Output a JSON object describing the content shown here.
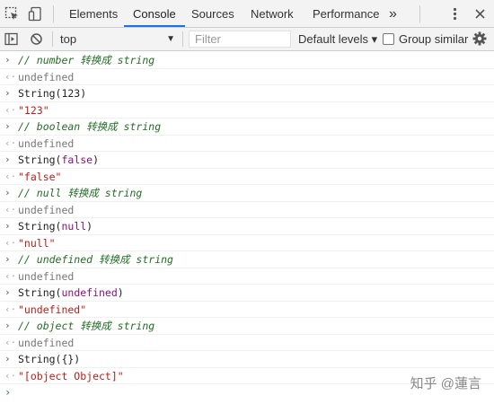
{
  "tabs": [
    "Elements",
    "Console",
    "Sources",
    "Network",
    "Performance"
  ],
  "more_tabs": "»",
  "toolbar": {
    "context": "top",
    "filter_placeholder": "Filter",
    "levels": "Default levels ▾",
    "group_similar": "Group similar"
  },
  "console": [
    {
      "kind": "in",
      "parts": [
        {
          "t": "// number 转换成 string",
          "c": "comment"
        }
      ]
    },
    {
      "kind": "out",
      "parts": [
        {
          "t": "undefined",
          "c": "undef"
        }
      ]
    },
    {
      "kind": "in",
      "parts": [
        {
          "t": "String(123)",
          "c": "plain"
        }
      ]
    },
    {
      "kind": "out",
      "parts": [
        {
          "t": "\"123\"",
          "c": "str"
        }
      ]
    },
    {
      "kind": "in",
      "parts": [
        {
          "t": "// boolean 转换成 string",
          "c": "comment"
        }
      ]
    },
    {
      "kind": "out",
      "parts": [
        {
          "t": "undefined",
          "c": "undef"
        }
      ]
    },
    {
      "kind": "in",
      "parts": [
        {
          "t": "String(",
          "c": "plain"
        },
        {
          "t": "false",
          "c": "kw"
        },
        {
          "t": ")",
          "c": "plain"
        }
      ]
    },
    {
      "kind": "out",
      "parts": [
        {
          "t": "\"false\"",
          "c": "str"
        }
      ]
    },
    {
      "kind": "in",
      "parts": [
        {
          "t": "// null 转换成 string",
          "c": "comment"
        }
      ]
    },
    {
      "kind": "out",
      "parts": [
        {
          "t": "undefined",
          "c": "undef"
        }
      ]
    },
    {
      "kind": "in",
      "parts": [
        {
          "t": "String(",
          "c": "plain"
        },
        {
          "t": "null",
          "c": "kw"
        },
        {
          "t": ")",
          "c": "plain"
        }
      ]
    },
    {
      "kind": "out",
      "parts": [
        {
          "t": "\"null\"",
          "c": "str"
        }
      ]
    },
    {
      "kind": "in",
      "parts": [
        {
          "t": "// undefined 转换成 string",
          "c": "comment"
        }
      ]
    },
    {
      "kind": "out",
      "parts": [
        {
          "t": "undefined",
          "c": "undef"
        }
      ]
    },
    {
      "kind": "in",
      "parts": [
        {
          "t": "String(",
          "c": "plain"
        },
        {
          "t": "undefined",
          "c": "kw"
        },
        {
          "t": ")",
          "c": "plain"
        }
      ]
    },
    {
      "kind": "out",
      "parts": [
        {
          "t": "\"undefined\"",
          "c": "str"
        }
      ]
    },
    {
      "kind": "in",
      "parts": [
        {
          "t": "// object 转换成 string",
          "c": "comment"
        }
      ]
    },
    {
      "kind": "out",
      "parts": [
        {
          "t": "undefined",
          "c": "undef"
        }
      ]
    },
    {
      "kind": "in",
      "parts": [
        {
          "t": "String({})",
          "c": "plain"
        }
      ]
    },
    {
      "kind": "out",
      "parts": [
        {
          "t": "\"[object Object]\"",
          "c": "str"
        }
      ]
    }
  ],
  "watermark": "知乎 @蓮言"
}
